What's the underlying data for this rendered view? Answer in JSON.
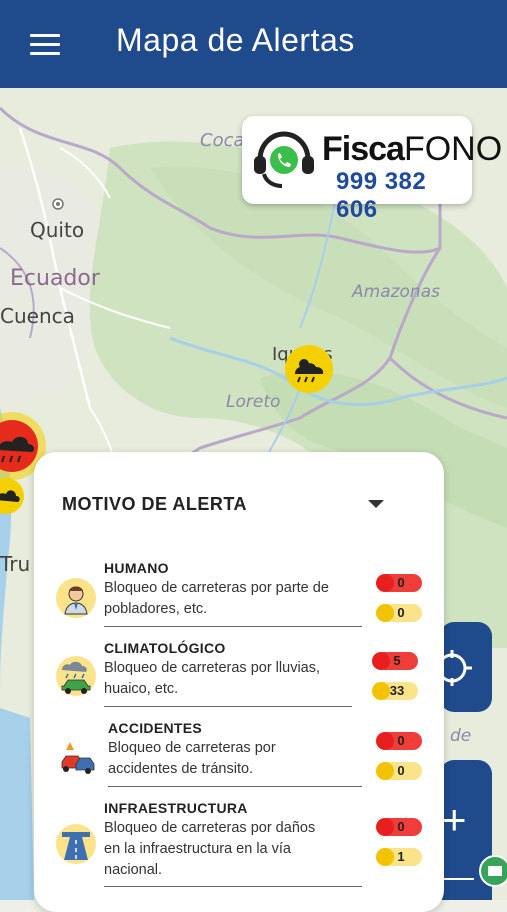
{
  "header": {
    "title": "Mapa de Alertas"
  },
  "map": {
    "labels": {
      "coca": "Coca",
      "quito": "Quito",
      "ecuador": "Ecuador",
      "cuenca": "Cuenca",
      "amazonas": "Amazonas",
      "iquitos": "Iquitos",
      "loreto": "Loreto",
      "trujillo": "Tru",
      "de": "de"
    }
  },
  "promo": {
    "brand_bold": "Fisca",
    "brand_light": "FONO",
    "phone": "999 382 606"
  },
  "panel": {
    "title": "MOTIVO DE ALERTA",
    "alerts": [
      {
        "name": "HUMANO",
        "desc_lines": [
          "Bloqueo de carreteras por parte de",
          "pobladores, etc."
        ],
        "red": "0",
        "yellow": "0"
      },
      {
        "name": "CLIMATOLÓGICO",
        "desc_lines": [
          "Bloqueo de carreteras por lluvias,",
          "huaico, etc."
        ],
        "red": "5",
        "yellow": "33"
      },
      {
        "name": "ACCIDENTES",
        "desc_lines": [
          "Bloqueo de carreteras por",
          "accidentes de tránsito."
        ],
        "red": "0",
        "yellow": "0"
      },
      {
        "name": "INFRAESTRUCTURA",
        "desc_lines": [
          "Bloqueo de carreteras por daños",
          "en la infraestructura en la vía",
          "nacional."
        ],
        "red": "0",
        "yellow": "1"
      }
    ]
  },
  "controls": {
    "zoom_in": "+"
  },
  "icons": {
    "menu": "hamburger-icon",
    "whatsapp": "whatsapp-headset-icon",
    "weather": "storm-cloud-icon",
    "locate": "crosshair-icon",
    "dropdown": "chevron-down-icon",
    "human": "person-icon",
    "climate": "rain-car-icon",
    "accident": "car-crash-icon",
    "infrastructure": "road-icon"
  },
  "colors": {
    "header": "#1f4a8c",
    "badge_red": "#ef3e3a",
    "badge_yellow": "#fbe38a",
    "phone": "#1f4aa0"
  }
}
